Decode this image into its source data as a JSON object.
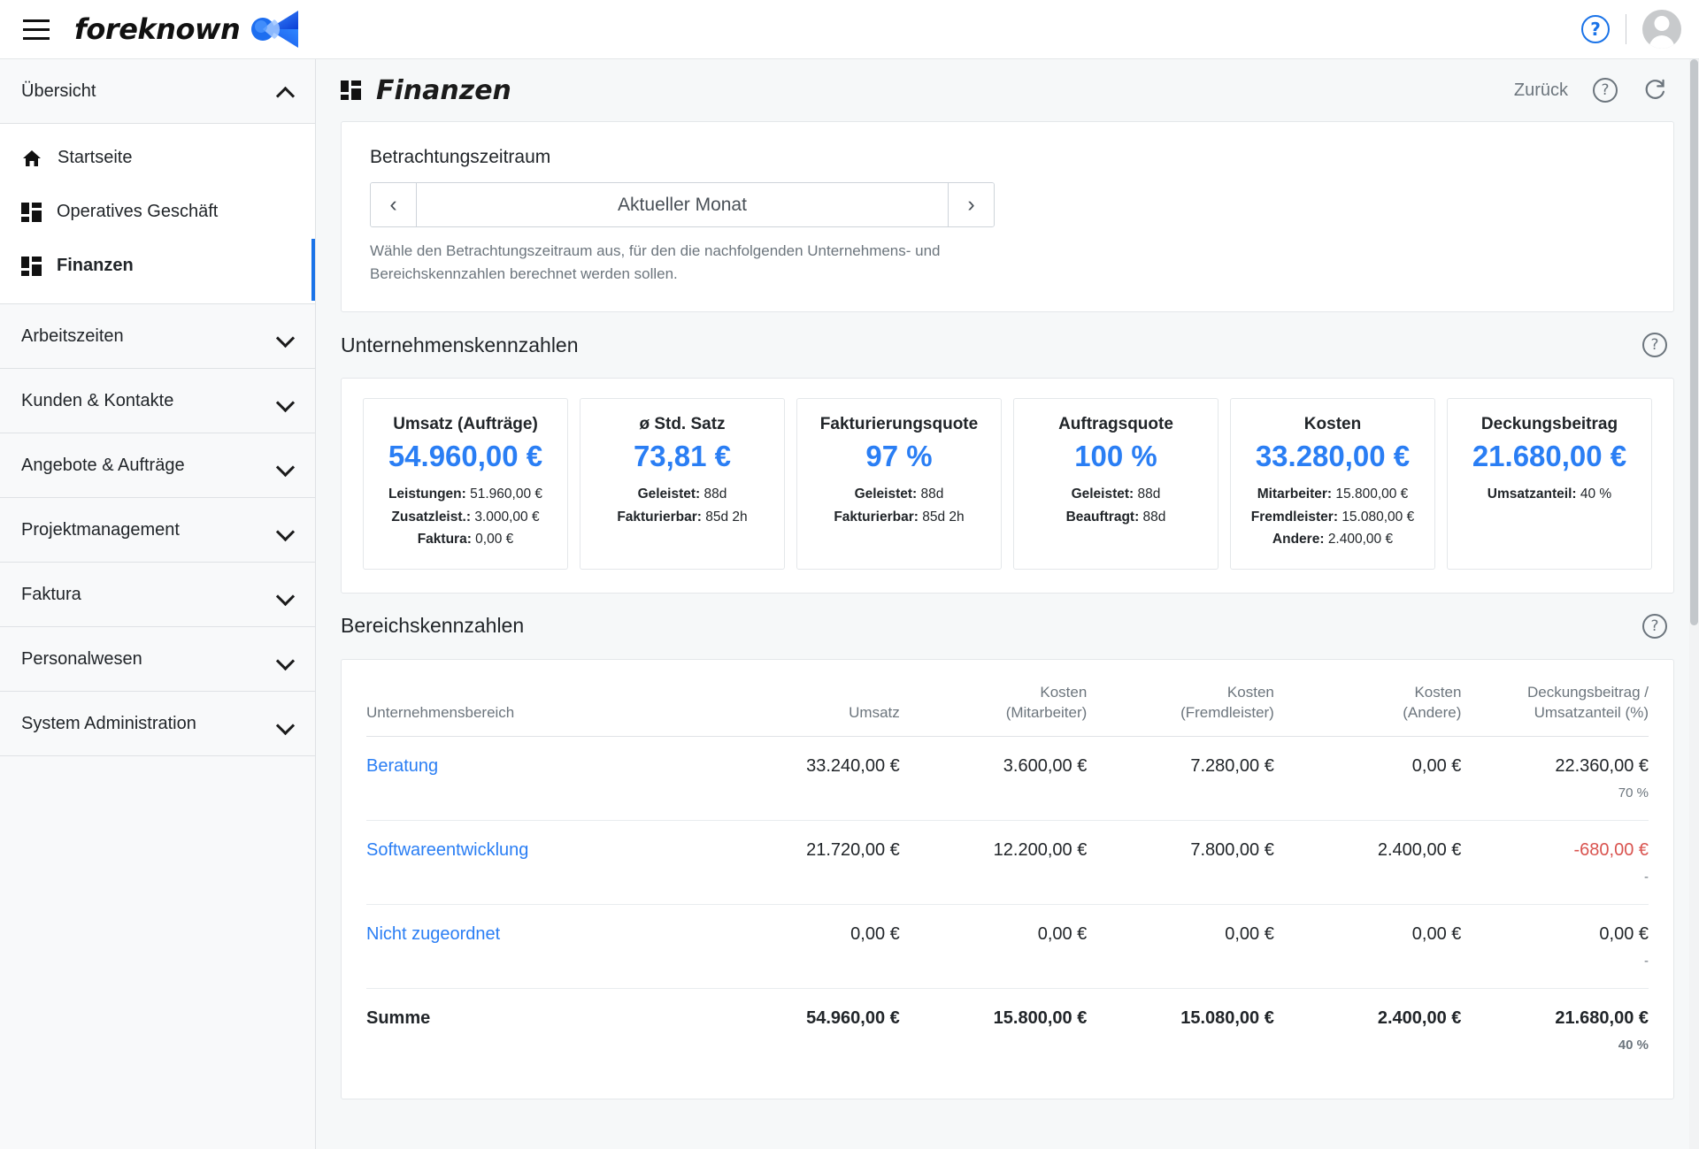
{
  "topbar": {
    "brand_name": "foreknown",
    "menu_icon": "hamburger-icon",
    "help_icon": "help-circle-icon",
    "avatar_icon": "user-avatar-icon"
  },
  "sidebar": {
    "groups": [
      {
        "label": "Übersicht",
        "expanded": true,
        "items": [
          {
            "label": "Startseite",
            "icon": "home-icon",
            "active": false
          },
          {
            "label": "Operatives Geschäft",
            "icon": "dashboard-grid-icon",
            "active": false
          },
          {
            "label": "Finanzen",
            "icon": "dashboard-grid-icon",
            "active": true
          }
        ]
      },
      {
        "label": "Arbeitszeiten",
        "expanded": false,
        "items": []
      },
      {
        "label": "Kunden & Kontakte",
        "expanded": false,
        "items": []
      },
      {
        "label": "Angebote & Aufträge",
        "expanded": false,
        "items": []
      },
      {
        "label": "Projektmanagement",
        "expanded": false,
        "items": []
      },
      {
        "label": "Faktura",
        "expanded": false,
        "items": []
      },
      {
        "label": "Personalwesen",
        "expanded": false,
        "items": []
      },
      {
        "label": "System Administration",
        "expanded": false,
        "items": []
      }
    ]
  },
  "page": {
    "title": "Finanzen",
    "title_icon": "dashboard-grid-icon",
    "back_label": "Zurück",
    "help_icon": "help-circle-icon",
    "refresh_icon": "refresh-icon"
  },
  "period": {
    "label": "Betrachtungszeitraum",
    "value": "Aktueller Monat",
    "prev_icon": "chevron-left-icon",
    "next_icon": "chevron-right-icon",
    "hint": "Wähle den Betrachtungszeitraum aus, für den die nachfolgenden Unternehmens- und Bereichskennzahlen berechnet werden sollen."
  },
  "company_metrics": {
    "title": "Unternehmenskennzahlen",
    "help_icon": "help-circle-icon",
    "cards": [
      {
        "title": "Umsatz (Aufträge)",
        "value": "54.960,00 €",
        "rows": [
          {
            "label": "Leistungen:",
            "value": "51.960,00 €"
          },
          {
            "label": "Zusatzleist.:",
            "value": "3.000,00 €"
          },
          {
            "label": "Faktura:",
            "value": "0,00 €"
          }
        ]
      },
      {
        "title": "ø Std. Satz",
        "value": "73,81 €",
        "rows": [
          {
            "label": "Geleistet:",
            "value": "88d"
          },
          {
            "label": "Fakturierbar:",
            "value": "85d 2h"
          }
        ]
      },
      {
        "title": "Fakturierungsquote",
        "value": "97 %",
        "rows": [
          {
            "label": "Geleistet:",
            "value": "88d"
          },
          {
            "label": "Fakturierbar:",
            "value": "85d 2h"
          }
        ]
      },
      {
        "title": "Auftragsquote",
        "value": "100 %",
        "rows": [
          {
            "label": "Geleistet:",
            "value": "88d"
          },
          {
            "label": "Beauftragt:",
            "value": "88d"
          }
        ]
      },
      {
        "title": "Kosten",
        "value": "33.280,00 €",
        "rows": [
          {
            "label": "Mitarbeiter:",
            "value": "15.800,00 €"
          },
          {
            "label": "Fremdleister:",
            "value": "15.080,00 €"
          },
          {
            "label": "Andere:",
            "value": "2.400,00 €"
          }
        ]
      },
      {
        "title": "Deckungsbeitrag",
        "value": "21.680,00 €",
        "rows": [
          {
            "label": "Umsatzanteil:",
            "value": "40 %"
          }
        ]
      }
    ]
  },
  "area_metrics": {
    "title": "Bereichskennzahlen",
    "help_icon": "help-circle-icon",
    "columns": [
      "Unternehmensbereich",
      "Umsatz",
      "Kosten\n(Mitarbeiter)",
      "Kosten\n(Fremdleister)",
      "Kosten\n(Andere)",
      "Deckungsbeitrag /\nUmsatzanteil (%)"
    ],
    "columns_split": [
      {
        "line1": "",
        "line2": "Unternehmensbereich"
      },
      {
        "line1": "",
        "line2": "Umsatz"
      },
      {
        "line1": "Kosten",
        "line2": "(Mitarbeiter)"
      },
      {
        "line1": "Kosten",
        "line2": "(Fremdleister)"
      },
      {
        "line1": "Kosten",
        "line2": "(Andere)"
      },
      {
        "line1": "Deckungsbeitrag /",
        "line2": "Umsatzanteil (%)"
      }
    ],
    "rows": [
      {
        "name": "Beratung",
        "is_link": true,
        "umsatz": "33.240,00 €",
        "kosten_mitarbeiter": "3.600,00 €",
        "kosten_fremdleister": "7.280,00 €",
        "kosten_andere": "0,00 €",
        "db": "22.360,00 €",
        "db_pct": "70 %",
        "db_negative": false
      },
      {
        "name": "Softwareentwicklung",
        "is_link": true,
        "umsatz": "21.720,00 €",
        "kosten_mitarbeiter": "12.200,00 €",
        "kosten_fremdleister": "7.800,00 €",
        "kosten_andere": "2.400,00 €",
        "db": "-680,00 €",
        "db_pct": "-",
        "db_negative": true
      },
      {
        "name": "Nicht zugeordnet",
        "is_link": true,
        "umsatz": "0,00 €",
        "kosten_mitarbeiter": "0,00 €",
        "kosten_fremdleister": "0,00 €",
        "kosten_andere": "0,00 €",
        "db": "0,00 €",
        "db_pct": "-",
        "db_negative": false
      }
    ],
    "total": {
      "name": "Summe",
      "umsatz": "54.960,00 €",
      "kosten_mitarbeiter": "15.800,00 €",
      "kosten_fremdleister": "15.080,00 €",
      "kosten_andere": "2.400,00 €",
      "db": "21.680,00 €",
      "db_pct": "40 %"
    }
  },
  "colors": {
    "accent": "#2a7ef4",
    "link": "#2a7ef4",
    "negative": "#d9534f",
    "muted": "#6c757d",
    "panel_bg": "#f6f8f9",
    "sidebar_bg": "#f8f9fa"
  }
}
